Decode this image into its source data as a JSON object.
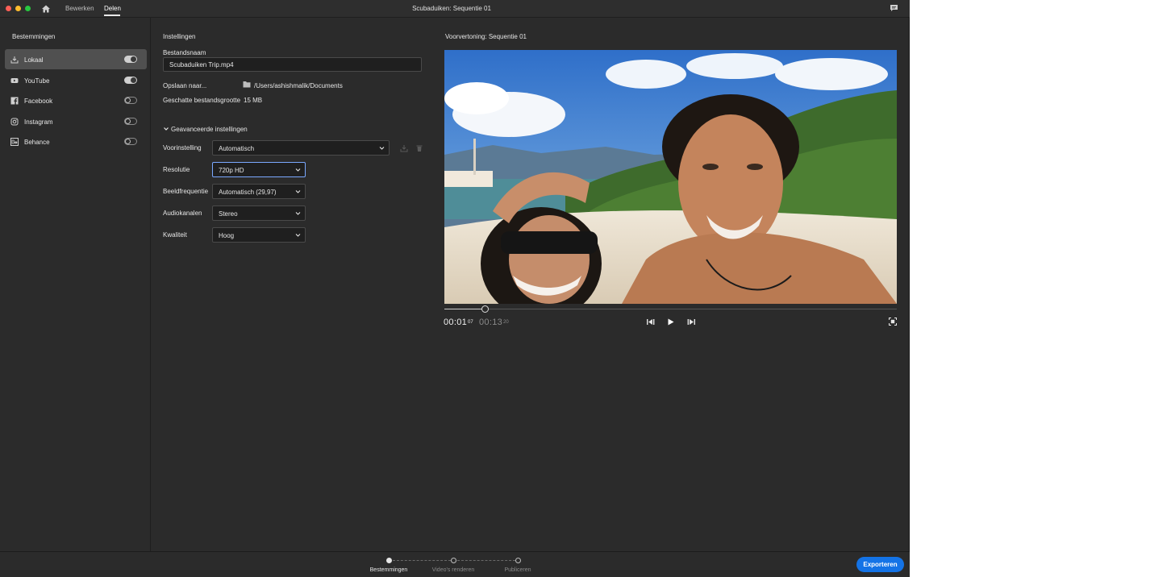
{
  "titlebar": {
    "tabs": [
      "Bewerken",
      "Delen"
    ],
    "active_tab": "Delen",
    "window_title": "Scubaduiken: Sequentie 01"
  },
  "sidebar": {
    "title": "Bestemmingen",
    "items": [
      {
        "label": "Lokaal",
        "icon": "download-icon",
        "enabled": true,
        "active": true
      },
      {
        "label": "YouTube",
        "icon": "youtube-icon",
        "enabled": true,
        "active": false
      },
      {
        "label": "Facebook",
        "icon": "facebook-icon",
        "enabled": false,
        "active": false
      },
      {
        "label": "Instagram",
        "icon": "instagram-icon",
        "enabled": false,
        "active": false
      },
      {
        "label": "Behance",
        "icon": "behance-icon",
        "enabled": false,
        "active": false
      }
    ]
  },
  "settings": {
    "title": "Instellingen",
    "filename_label": "Bestandsnaam",
    "filename_value": "Scubaduiken Trip.mp4",
    "saveto_label": "Opslaan naar...",
    "saveto_path": "/Users/ashishmalik/Documents",
    "size_label": "Geschatte bestandsgrootte",
    "size_value": "15 MB",
    "advanced_label": "Geavanceerde instellingen",
    "fields": [
      {
        "label": "Voorinstelling",
        "value": "Automatisch"
      },
      {
        "label": "Resolutie",
        "value": "720p HD"
      },
      {
        "label": "Beeldfrequentie",
        "value": "Automatisch (29,97)"
      },
      {
        "label": "Audiokanalen",
        "value": "Stereo"
      },
      {
        "label": "Kwaliteit",
        "value": "Hoog"
      }
    ]
  },
  "preview": {
    "title": "Voorvertoning: Sequentie 01",
    "time_current": "00:01",
    "time_current_frames": "07",
    "time_total": "00:13",
    "time_total_frames": "20",
    "progress": 0.09
  },
  "bottombar": {
    "steps": [
      "Bestemmingen",
      "Video's renderen",
      "Publiceren"
    ],
    "current_step": 0,
    "export_label": "Exporteren"
  },
  "colors": {
    "background": "#2b2b2b",
    "accent": "#1473e6",
    "focus": "#7aa8ff"
  }
}
